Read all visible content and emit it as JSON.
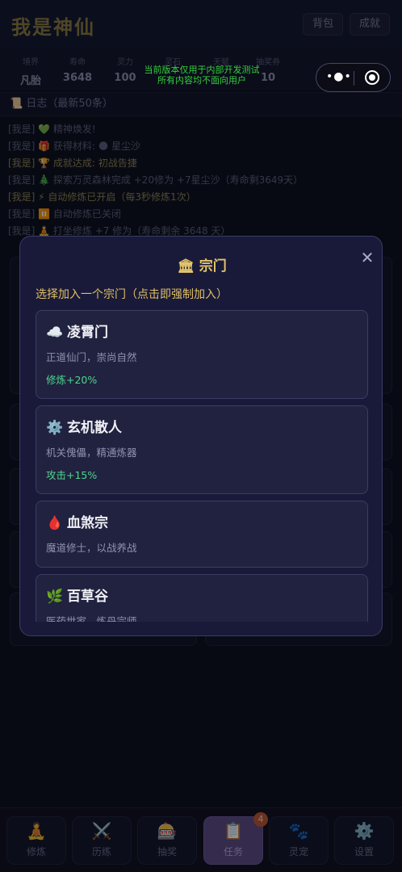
{
  "app": {
    "title": "我是神仙",
    "bag_label": "背包",
    "achievements_label": "成就"
  },
  "stats": [
    {
      "label": "境界",
      "value": "凡胎"
    },
    {
      "label": "寿命",
      "value": "3648"
    },
    {
      "label": "灵力",
      "value": "100"
    },
    {
      "label": "灵石",
      "value": ""
    },
    {
      "label": "天赋",
      "value": ""
    },
    {
      "label": "抽奖券",
      "value": "10"
    }
  ],
  "dev_notice": {
    "line1": "当前版本仅用于内部开发测试",
    "line2": "所有内容均不面向用户"
  },
  "log": {
    "header": "日志（最新50条）",
    "header_icon": "scroll-icon",
    "lines": [
      "[我是] 💚 精神焕发!",
      "[我是] 🎁 获得材料: 🌑 星尘沙",
      "[我是] 🏆 成就达成: 初战告捷",
      "[我是] 🎄 探索万灵森林完成 +20修为 +7星尘沙（寿命剩3649天）",
      "[我是] ⚡ 自动修炼已开启（每3秒修炼1次）",
      "[我是] ⏸️ 自动修炼已关闭",
      "[我是] 🧘 打坐修炼 +7 修为（寿命剩余 3648 天）"
    ]
  },
  "modal": {
    "title_icon": "🏛",
    "title": "宗门",
    "subtitle": "选择加入一个宗门（点击即强制加入）",
    "sects": [
      {
        "icon": "☁️",
        "name": "凌霄门",
        "desc": "正道仙门，崇尚自然",
        "bonus": "修炼+20%"
      },
      {
        "icon": "⚙️",
        "name": "玄机散人",
        "desc": "机关傀儡，精通炼器",
        "bonus": "攻击+15%"
      },
      {
        "icon": "🩸",
        "name": "血煞宗",
        "desc": "魔道修士，以战养战",
        "bonus": ""
      },
      {
        "icon": "🌿",
        "name": "百草谷",
        "desc": "医药世家，炼丹宗师",
        "bonus": ""
      }
    ]
  },
  "nav": [
    {
      "icon": "🧘",
      "label": "修炼"
    },
    {
      "icon": "⚔️",
      "label": "历练"
    },
    {
      "icon": "🎰",
      "label": "抽奖"
    },
    {
      "icon": "📋",
      "label": "任务"
    },
    {
      "icon": "🐾",
      "label": "灵宠"
    },
    {
      "icon": "⚙️",
      "label": "设置"
    }
  ],
  "nav_badge": "4",
  "colors": {
    "accent_gold": "#e4c56a",
    "bonus_green": "#4fd68c",
    "modal_bg": "#191a3a",
    "active_tab": "#5b4a82",
    "badge": "#c0562e"
  }
}
